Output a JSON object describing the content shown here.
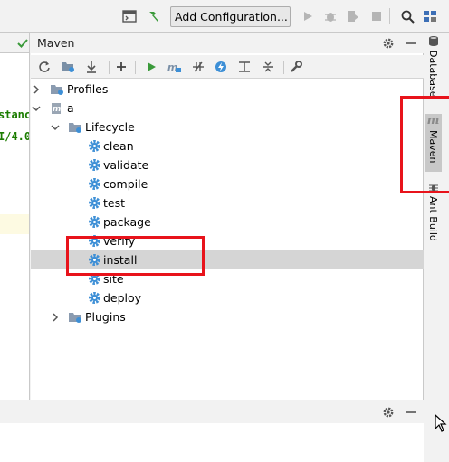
{
  "toolbar": {
    "run_config_label": "Add Configuration..."
  },
  "editor": {
    "code_line_1": "stanc",
    "code_line_2": "I/4.0"
  },
  "maven_panel": {
    "title": "Maven"
  },
  "tree": {
    "profiles": "Profiles",
    "project": "a",
    "lifecycle": "Lifecycle",
    "phases": [
      "clean",
      "validate",
      "compile",
      "test",
      "package",
      "verify",
      "install",
      "site",
      "deploy"
    ],
    "plugins": "Plugins",
    "selected": "install"
  },
  "right_strip": {
    "database": "Database",
    "maven": "Maven",
    "ant_build": "Ant Build",
    "maven_icon_letter": "m"
  },
  "colors": {
    "annotation": "#e8131b",
    "selection": "#d5d5d5",
    "run_green": "#3a9a3a",
    "gear_blue": "#3d8fd6"
  }
}
